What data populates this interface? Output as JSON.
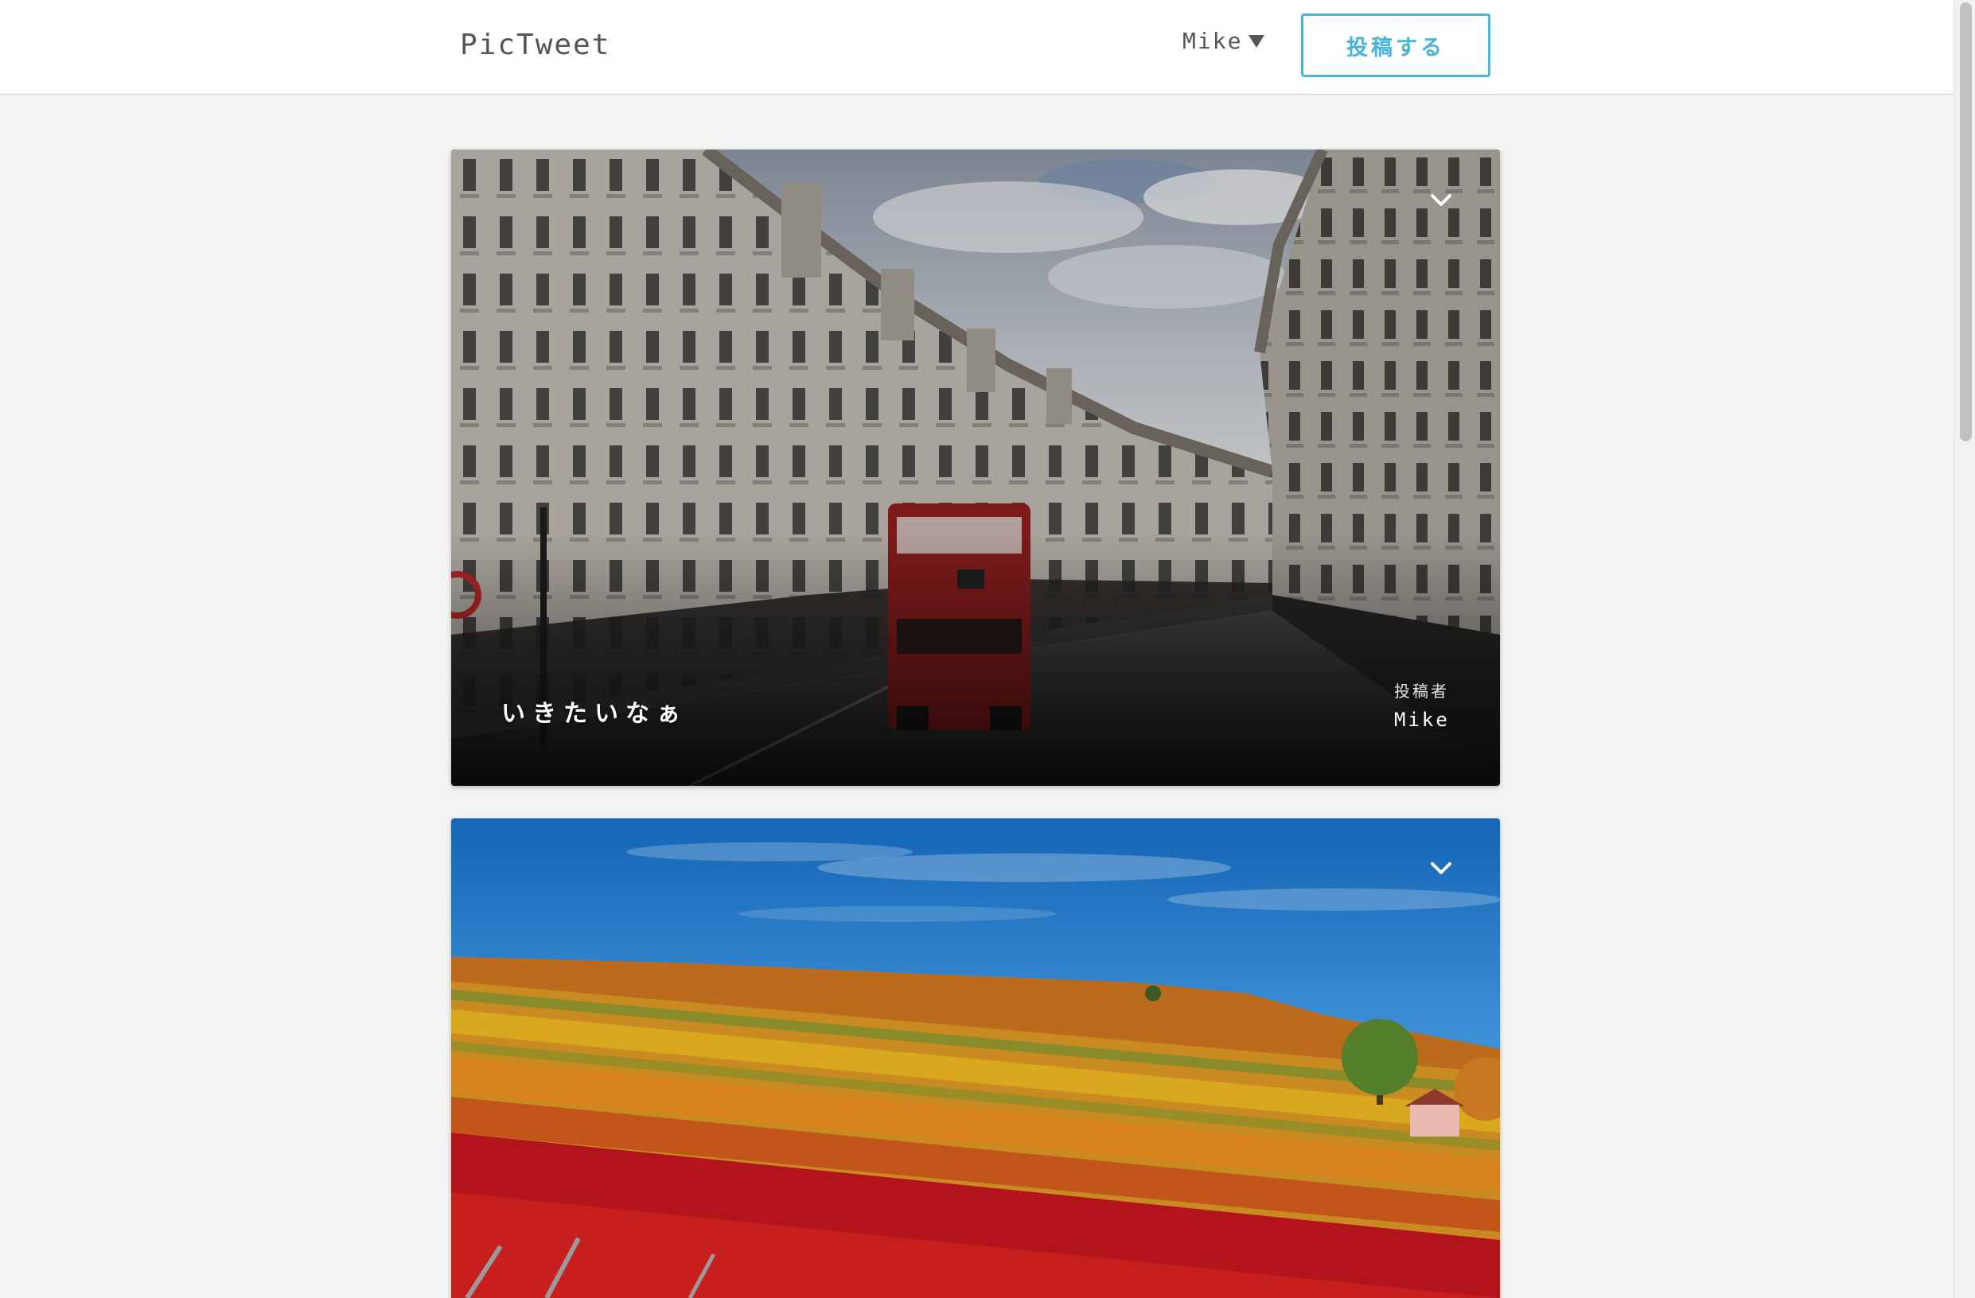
{
  "header": {
    "logo": "PicTweet",
    "user_menu": {
      "label": "Mike",
      "caret_icon": "caret-down-icon"
    },
    "post_button": "投稿する"
  },
  "tweets": [
    {
      "text": "いきたいなぁ",
      "author_label": "投稿者",
      "author": "Mike",
      "menu_icon": "chevron-down-icon"
    },
    {
      "menu_icon": "chevron-down-icon"
    }
  ],
  "colors": {
    "accent": "#45b5da",
    "page_background": "#f3f3f2",
    "header_background": "#ffffff",
    "header_text": "#555555"
  }
}
